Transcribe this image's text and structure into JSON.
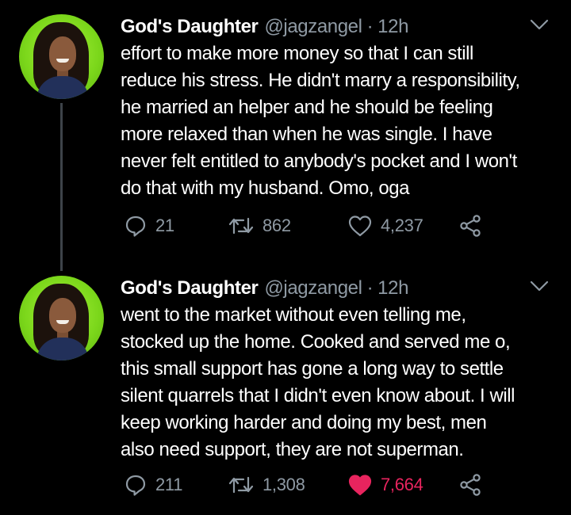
{
  "tweets": [
    {
      "name": "God's Daughter",
      "handle": "@jagzangel",
      "separator": "·",
      "time": "12h",
      "lines": [
        "effort to make more money so that I can still",
        "reduce his stress. He didn't marry a responsibility,",
        "he married an helper and he should be feeling",
        "more relaxed than when he was single. I have",
        "never felt entitled to anybody's pocket and I won't",
        "do that with my husband. Omo, oga"
      ],
      "replies": "21",
      "retweets": "862",
      "likes": "4,237",
      "liked": false
    },
    {
      "name": "God's Daughter",
      "handle": "@jagzangel",
      "separator": "·",
      "time": "12h",
      "lines": [
        "went to the market without even telling me,",
        "stocked up the home. Cooked and served me o,",
        "this small support has gone a long way to settle",
        "silent quarrels that I didn't even know about. I will",
        "keep working harder and doing my best, men",
        "also need support, they are not superman."
      ],
      "replies": "211",
      "retweets": "1,308",
      "likes": "7,664",
      "liked": true
    }
  ],
  "icons": {
    "reply": "reply-icon",
    "retweet": "retweet-icon",
    "like": "heart-icon",
    "share": "share-icon",
    "more": "chevron-down-icon"
  },
  "colors": {
    "background": "#000000",
    "text": "#ffffff",
    "muted": "#8f9aa4",
    "like_active": "#e8245e",
    "thread_line": "#3d4349"
  }
}
